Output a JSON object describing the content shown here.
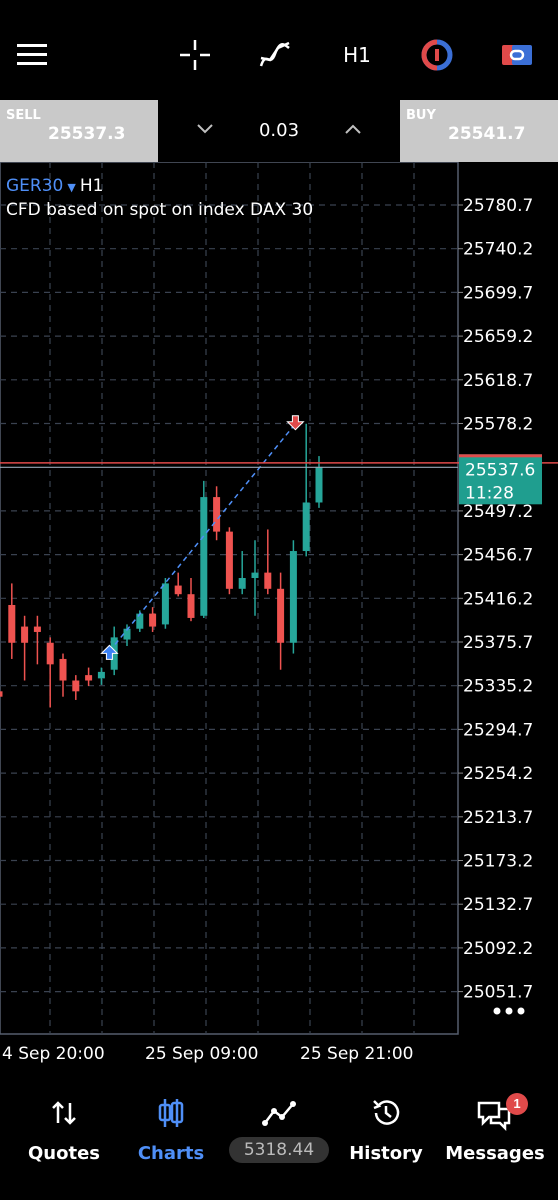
{
  "toolbar": {
    "menu_icon": "hamburger-icon",
    "crosshair_icon": "crosshair-icon",
    "indicators_icon": "indicators-icon",
    "timeframe": "H1",
    "oneclick_icon": "one-click-trading-icon",
    "trade_icon": "trade-icon"
  },
  "trade": {
    "sell_label": "SELL",
    "sell_price": "25537.3",
    "buy_label": "BUY",
    "buy_price": "25541.7",
    "volume": "0.03"
  },
  "chart_header": {
    "symbol": "GER30",
    "timeframe": "H1",
    "description": "CFD based on spot on index DAX 30"
  },
  "price_tag": {
    "price": "25537.6",
    "time": "11:28"
  },
  "colors": {
    "bull": "#26a69a",
    "bear": "#ef5350",
    "accent": "#4f8ff7",
    "grid": "#3a4250"
  },
  "chart_data": {
    "type": "candlestick",
    "y_ticks": [
      "25780.7",
      "25740.2",
      "25699.7",
      "25659.2",
      "25618.7",
      "25578.2",
      "25497.2",
      "25456.7",
      "25416.2",
      "25375.7",
      "25335.2",
      "25294.7",
      "25254.2",
      "25213.7",
      "25173.2",
      "25132.7",
      "25092.2",
      "25051.7"
    ],
    "x_ticks": [
      "4 Sep 20:00",
      "25 Sep 09:00",
      "25 Sep 21:00"
    ],
    "ylim": [
      25030,
      25800
    ],
    "bid_line": 25537.6,
    "ask_line": 25541.7,
    "candles": [
      {
        "o": 25330,
        "h": 25340,
        "l": 25300,
        "c": 25325
      },
      {
        "o": 25410,
        "h": 25430,
        "l": 25360,
        "c": 25375
      },
      {
        "o": 25390,
        "h": 25400,
        "l": 25340,
        "c": 25375
      },
      {
        "o": 25390,
        "h": 25400,
        "l": 25355,
        "c": 25385
      },
      {
        "o": 25375,
        "h": 25380,
        "l": 25315,
        "c": 25355
      },
      {
        "o": 25360,
        "h": 25365,
        "l": 25325,
        "c": 25340
      },
      {
        "o": 25340,
        "h": 25345,
        "l": 25322,
        "c": 25330
      },
      {
        "o": 25345,
        "h": 25352,
        "l": 25335,
        "c": 25340
      },
      {
        "o": 25342,
        "h": 25352,
        "l": 25336,
        "c": 25348
      },
      {
        "o": 25350,
        "h": 25390,
        "l": 25345,
        "c": 25380
      },
      {
        "o": 25378,
        "h": 25392,
        "l": 25372,
        "c": 25388
      },
      {
        "o": 25388,
        "h": 25405,
        "l": 25385,
        "c": 25402
      },
      {
        "o": 25402,
        "h": 25408,
        "l": 25385,
        "c": 25390
      },
      {
        "o": 25392,
        "h": 25435,
        "l": 25388,
        "c": 25430
      },
      {
        "o": 25428,
        "h": 25440,
        "l": 25418,
        "c": 25420
      },
      {
        "o": 25420,
        "h": 25435,
        "l": 25395,
        "c": 25398
      },
      {
        "o": 25400,
        "h": 25525,
        "l": 25398,
        "c": 25510
      },
      {
        "o": 25510,
        "h": 25520,
        "l": 25470,
        "c": 25478
      },
      {
        "o": 25478,
        "h": 25482,
        "l": 25420,
        "c": 25425
      },
      {
        "o": 25425,
        "h": 25460,
        "l": 25420,
        "c": 25435
      },
      {
        "o": 25435,
        "h": 25470,
        "l": 25400,
        "c": 25440
      },
      {
        "o": 25440,
        "h": 25480,
        "l": 25420,
        "c": 25425
      },
      {
        "o": 25425,
        "h": 25440,
        "l": 25350,
        "c": 25375
      },
      {
        "o": 25375,
        "h": 25470,
        "l": 25365,
        "c": 25460
      },
      {
        "o": 25460,
        "h": 25578,
        "l": 25455,
        "c": 25505
      },
      {
        "o": 25505,
        "h": 25548,
        "l": 25500,
        "c": 25538
      }
    ],
    "trade_markers": [
      {
        "type": "buy",
        "price": 25367
      },
      {
        "type": "sell",
        "price": 25578
      }
    ]
  },
  "nav": {
    "quotes": "Quotes",
    "charts": "Charts",
    "balance": "5318.44",
    "history": "History",
    "messages": "Messages",
    "messages_badge": "1"
  }
}
